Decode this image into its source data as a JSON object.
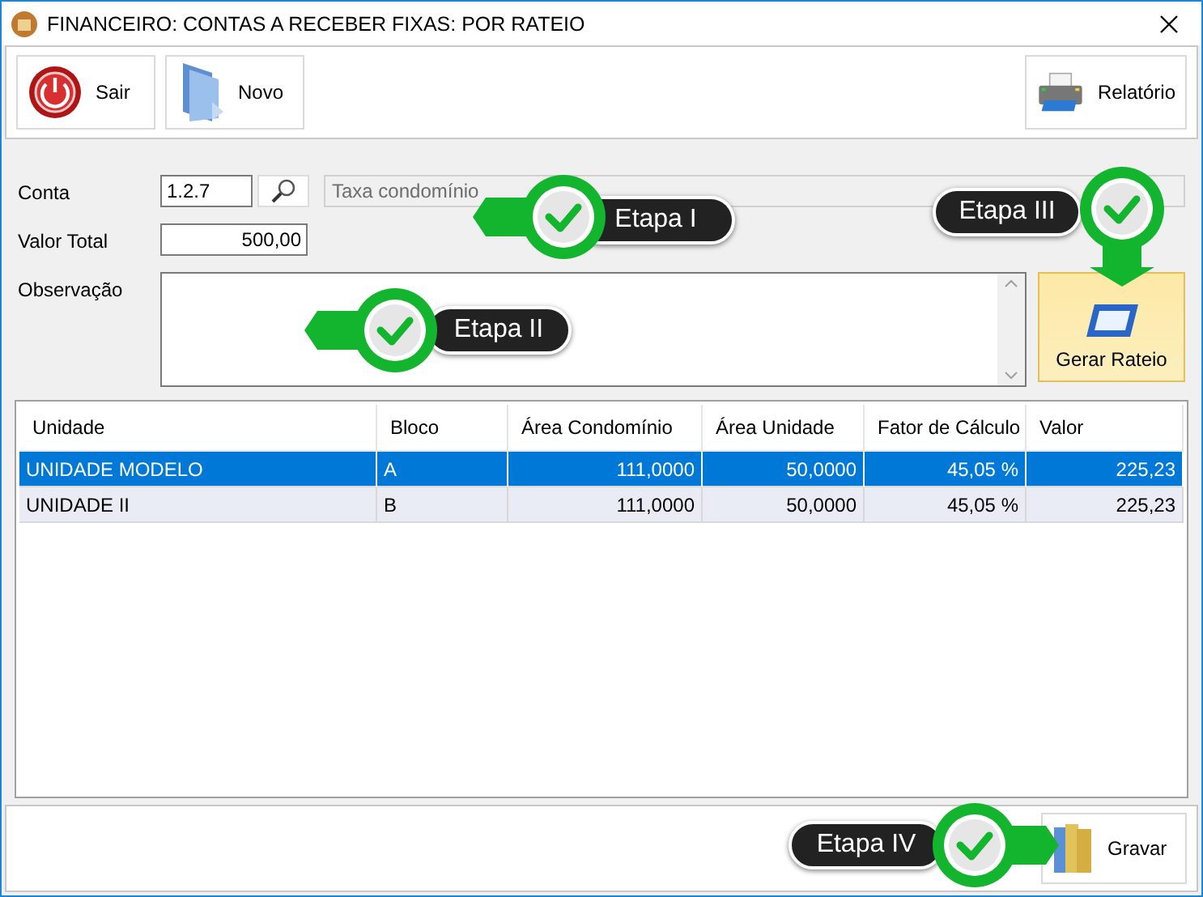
{
  "window": {
    "title": "FINANCEIRO: CONTAS A RECEBER FIXAS: POR RATEIO"
  },
  "toolbar": {
    "left": [
      {
        "kind": "exit",
        "label": "Sair"
      },
      {
        "kind": "new",
        "label": "Novo"
      }
    ],
    "right": [
      {
        "kind": "print",
        "label": "Relatório"
      }
    ]
  },
  "form": {
    "conta": {
      "label": "Conta",
      "code": "1.2.7",
      "description": "Taxa condomínio"
    },
    "valor_total": {
      "label": "Valor Total",
      "value": "500,00"
    },
    "observacao": {
      "label": "Observação"
    },
    "generate_button": {
      "label": "Gerar Rateio"
    }
  },
  "table": {
    "columns": [
      "Unidade",
      "Bloco",
      "Área Condomínio",
      "Área Unidade",
      "Fator de Cálculo",
      "Valor"
    ],
    "rows": [
      {
        "selected": true,
        "cells": [
          "UNIDADE MODELO",
          "A",
          "111,0000",
          "50,0000",
          "45,05 %",
          "225,23"
        ]
      },
      {
        "selected": false,
        "cells": [
          "UNIDADE II",
          "B",
          "111,0000",
          "50,0000",
          "45,05 %",
          "225,23"
        ]
      }
    ]
  },
  "footer": {
    "save_button": {
      "label": "Gravar"
    }
  },
  "callouts": [
    {
      "label": "Etapa I"
    },
    {
      "label": "Etapa II"
    },
    {
      "label": "Etapa III"
    },
    {
      "label": "Etapa IV"
    }
  ]
}
